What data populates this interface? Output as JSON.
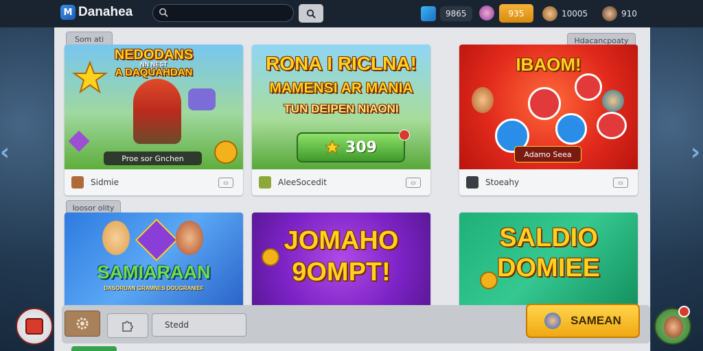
{
  "app": {
    "title": "Danahea"
  },
  "search": {
    "placeholder": ""
  },
  "topbar": {
    "stat1": "9865",
    "coins": "935",
    "stat2": "10005",
    "stat3": "910"
  },
  "sections": {
    "tag_top_left": "Som ati",
    "tag_top_right": "Hdacancpoaty",
    "tag_mid_left": "Ioosor olity"
  },
  "cards": [
    {
      "title_line1": "NEDODANS",
      "title_line2": "A DAQUAHDAN",
      "subtitle": "NN NEST",
      "banner": "Proe sor Gnchen",
      "footer_label": "Sidmie"
    },
    {
      "title_line1": "RONA I RICLNA!",
      "title_line2": "MAMENSI AR MANIA",
      "title_line3": "TUN DEIPEN NIAONI",
      "score": "309",
      "footer_label": "AleeSocedit"
    },
    {
      "title_line1": "IBAOM!",
      "banner": "Adamo Seea",
      "footer_label": "Stoeahy"
    },
    {
      "title_line1": "SAMIARAAN",
      "subtitle": "DASORUAN GRAMNES DOUGRANIEF"
    },
    {
      "title_line1": "JOMAHO",
      "title_line2": "9OMPT!"
    },
    {
      "title_line1": "SALDIO",
      "title_line2": "DOMIEE"
    }
  ],
  "bottombar": {
    "field_label": "Stedd"
  },
  "cta": {
    "label": "SAMEAN"
  },
  "colors": {
    "accent": "#f0a812",
    "topbar": "#1a2330",
    "panel": "#e4e6ea"
  }
}
